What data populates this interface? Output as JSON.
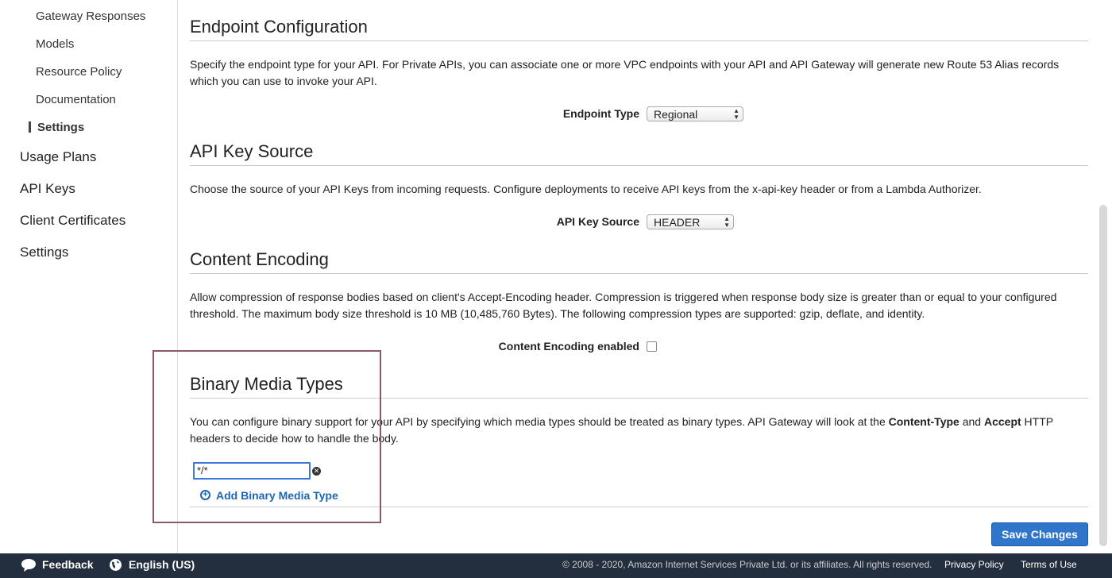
{
  "sidebar": {
    "sub_items": [
      {
        "label": "Gateway Responses"
      },
      {
        "label": "Models"
      },
      {
        "label": "Resource Policy"
      },
      {
        "label": "Documentation"
      },
      {
        "label": "Settings",
        "active": true
      }
    ],
    "main_items": [
      {
        "label": "Usage Plans"
      },
      {
        "label": "API Keys"
      },
      {
        "label": "Client Certificates"
      },
      {
        "label": "Settings"
      }
    ]
  },
  "sections": {
    "endpoint": {
      "title": "Endpoint Configuration",
      "description": "Specify the endpoint type for your API. For Private APIs, you can associate one or more VPC endpoints with your API and API Gateway will generate new Route 53 Alias records which you can use to invoke your API.",
      "field_label": "Endpoint Type",
      "selected_value": "Regional"
    },
    "api_key_source": {
      "title": "API Key Source",
      "description": "Choose the source of your API Keys from incoming requests. Configure deployments to receive API keys from the x-api-key header or from a Lambda Authorizer.",
      "field_label": "API Key Source",
      "selected_value": "HEADER"
    },
    "content_encoding": {
      "title": "Content Encoding",
      "description": "Allow compression of response bodies based on client's Accept-Encoding header. Compression is triggered when response body size is greater than or equal to your configured threshold. The maximum body size threshold is 10 MB (10,485,760 Bytes). The following compression types are supported: gzip, deflate, and identity.",
      "field_label": "Content Encoding enabled",
      "checked": false
    },
    "binary_media": {
      "title": "Binary Media Types",
      "description_pre": "You can configure binary support for your API by specifying which media types should be treated as binary types. API Gateway will look at the ",
      "description_bold1": "Content-Type",
      "description_mid": " and ",
      "description_bold2": "Accept",
      "description_post": " HTTP headers to decide how to handle the body.",
      "input_value": "*/*",
      "add_label": "Add Binary Media Type"
    }
  },
  "actions": {
    "save_label": "Save Changes"
  },
  "footer": {
    "feedback": "Feedback",
    "language": "English (US)",
    "copyright": "© 2008 - 2020, Amazon Internet Services Private Ltd. or its affiliates. All rights reserved.",
    "privacy": "Privacy Policy",
    "terms": "Terms of Use"
  },
  "colors": {
    "accent": "#2f75c9",
    "link": "#1f66b3",
    "footer_bg": "#232f3e",
    "highlight": "#8a5a6a"
  }
}
